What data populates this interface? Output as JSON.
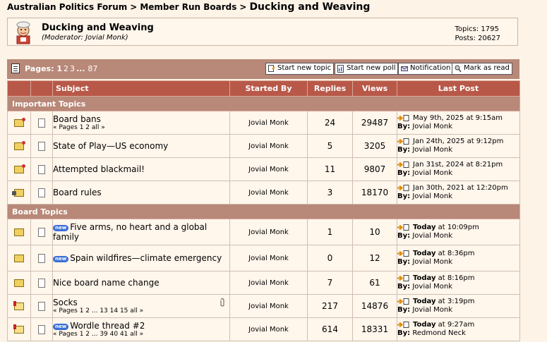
{
  "breadcrumb": {
    "items": [
      "Australian Politics Forum",
      "Member Run Boards"
    ],
    "current": "Ducking and Weaving"
  },
  "board": {
    "title": "Ducking and Weaving",
    "moderator_line": "(Moderator: Jovial Monk)",
    "topics_stat": "Topics: 1795",
    "posts_stat": "Posts: 20627"
  },
  "toolbar": {
    "pages_label": "Pages:",
    "pages": [
      "1",
      "2",
      "3",
      "...",
      "87"
    ],
    "buttons": {
      "start_topic": "Start new topic",
      "start_poll": "Start new poll",
      "notification": "Notification",
      "mark_read": "Mark as read"
    }
  },
  "table": {
    "headers": {
      "subject": "Subject",
      "started_by": "Started By",
      "replies": "Replies",
      "views": "Views",
      "last_post": "Last Post"
    },
    "sections": {
      "important": "Important Topics",
      "board": "Board Topics"
    },
    "rows": [
      {
        "title": "Board bans",
        "pages": "« Pages 1 2 all »",
        "starter": "Jovial Monk",
        "replies": "24",
        "views": "29487",
        "lp_date": "May 9th, 2025 at 9:15am",
        "lp_by": "Jovial Monk"
      },
      {
        "title": "State of Play—US economy",
        "pages": "",
        "starter": "Jovial Monk",
        "replies": "5",
        "views": "3205",
        "lp_date": "Jan 24th, 2025 at 9:12pm",
        "lp_by": "Jovial Monk"
      },
      {
        "title": "Attempted blackmail!",
        "pages": "",
        "starter": "Jovial Monk",
        "replies": "11",
        "views": "9807",
        "lp_date": "Jan 31st, 2024 at 8:21pm",
        "lp_by": "Jovial Monk"
      },
      {
        "title": "Board rules",
        "pages": "",
        "starter": "Jovial Monk",
        "replies": "3",
        "views": "18170",
        "lp_date": "Jan 30th, 2021 at 12:20pm",
        "lp_by": "Jovial Monk"
      },
      {
        "title": "Five arms, no heart and a global family",
        "pages": "",
        "starter": "Jovial Monk",
        "replies": "1",
        "views": "10",
        "lp_today": "Today",
        "lp_time": "at 10:09pm",
        "lp_by": "Jovial Monk",
        "badge": "new"
      },
      {
        "title": "Spain wildfires—climate emergency",
        "pages": "",
        "starter": "Jovial Monk",
        "replies": "0",
        "views": "12",
        "lp_today": "Today",
        "lp_time": "at 8:36pm",
        "lp_by": "Jovial Monk",
        "badge": "new"
      },
      {
        "title": "Nice board name change",
        "pages": "",
        "starter": "Jovial Monk",
        "replies": "7",
        "views": "61",
        "lp_today": "Today",
        "lp_time": "at 8:16pm",
        "lp_by": "Jovial Monk"
      },
      {
        "title": "Socks",
        "pages": "« Pages 1 2 ... 13 14 15 all »",
        "starter": "Jovial Monk",
        "replies": "217",
        "views": "14876",
        "lp_today": "Today",
        "lp_time": "at 3:19pm",
        "lp_by": "Jovial Monk"
      },
      {
        "title": "Wordle thread #2",
        "pages": "« Pages 1 2 ... 39 40 41 all »",
        "starter": "Jovial Monk",
        "replies": "614",
        "views": "18331",
        "lp_today": "Today",
        "lp_time": "at 9:27am",
        "lp_by": "Redmond Neck",
        "badge": "new"
      }
    ],
    "by_label": "By:"
  },
  "colors": {
    "page_bg": "#fdf3e7",
    "header_bg": "#b85848",
    "section_bg": "#b88878",
    "badge": "#3b6fd6"
  }
}
